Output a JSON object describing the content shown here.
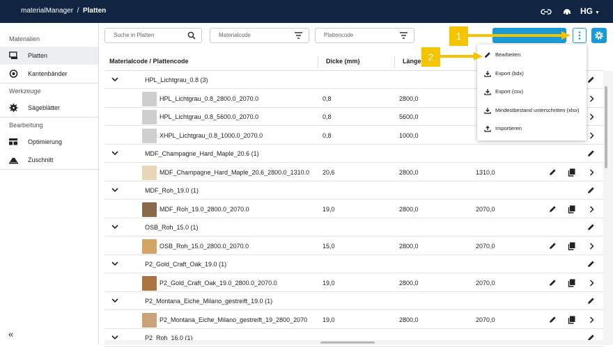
{
  "app": {
    "name": "materialManager",
    "separator": "/",
    "page": "Platten",
    "brand": "HG"
  },
  "sidebar": {
    "sections": [
      {
        "title": "Materialien",
        "items": [
          {
            "label": "Platten",
            "icon": "sheet-icon",
            "active": true
          },
          {
            "label": "Kantenbänder",
            "icon": "edge-band-icon",
            "active": false
          }
        ]
      },
      {
        "title": "Werkzeuge",
        "items": [
          {
            "label": "Sägeblätter",
            "icon": "saw-blade-icon",
            "active": false
          }
        ]
      },
      {
        "title": "Bearbeitung",
        "items": [
          {
            "label": "Optimierung",
            "icon": "optimization-icon",
            "active": false
          },
          {
            "label": "Zuschnitt",
            "icon": "cutting-icon",
            "active": false
          }
        ]
      }
    ],
    "collapse": "«"
  },
  "filters": {
    "search_placeholder": "Suche in Platten",
    "materialcode_placeholder": "Materialcode",
    "plattencode_placeholder": "Plattencode"
  },
  "table": {
    "headers": [
      "Materialcode / Plattencode",
      "Dicke (mm)",
      "Länge"
    ]
  },
  "groups": [
    {
      "name": "HPL_Lichtgrau_0.8 (3)",
      "rows": [
        {
          "code": "HPL_Lichtgrau_0.8_2800.0_2070.0",
          "dicke": "0,8",
          "laenge": "2800,0",
          "breite": "",
          "thumb": "#cfcfcf"
        },
        {
          "code": "HPL_Lichtgrau_0.8_5600.0_2070.0",
          "dicke": "0,8",
          "laenge": "5600,0",
          "breite": "",
          "thumb": "#cfcfcf"
        },
        {
          "code": "XHPL_Lichtgrau_0.8_1000.0_2070.0",
          "dicke": "0,8",
          "laenge": "1000,0",
          "breite": "",
          "thumb": "#cfcfcf"
        }
      ]
    },
    {
      "name": "MDF_Champagne_Hard_Maple_20.6 (1)",
      "rows": [
        {
          "code": "MDF_Champagne_Hard_Maple_20.6_2800.0_1310.0",
          "dicke": "20,6",
          "laenge": "2800,0",
          "breite": "1310,0",
          "thumb": "#e9d5b8"
        }
      ]
    },
    {
      "name": "MDF_Roh_19.0 (1)",
      "rows": [
        {
          "code": "MDF_Roh_19.0_2800.0_2070.0",
          "dicke": "19,0",
          "laenge": "2800,0",
          "breite": "2070,0",
          "thumb": "#8a6a4c"
        }
      ]
    },
    {
      "name": "OSB_Roh_15.0 (1)",
      "rows": [
        {
          "code": "OSB_Roh_15.0_2800.0_2070.0",
          "dicke": "15,0",
          "laenge": "2800,0",
          "breite": "2070,0",
          "thumb": "#d4a467"
        }
      ]
    },
    {
      "name": "P2_Gold_Craft_Oak_19.0 (1)",
      "rows": [
        {
          "code": "P2_Gold_Craft_Oak_19.0_2800.0_2070.0",
          "dicke": "19,0",
          "laenge": "2800,0",
          "breite": "2070,0",
          "thumb": "#a9743f"
        }
      ]
    },
    {
      "name": "P2_Montana_Eiche_Milano_gestreift_19.0 (1)",
      "rows": [
        {
          "code": "P2_Montana_Eiche_Milano_gestreift_19_2800_2070",
          "dicke": "19,0",
          "laenge": "2800,0",
          "breite": "2070,0",
          "thumb": "#cba27a"
        }
      ]
    },
    {
      "name": "P2_Roh_16.0 (1)",
      "rows": []
    }
  ],
  "menu": [
    {
      "label": "Bearbeiten",
      "icon": "pencil-icon"
    },
    {
      "label": "Export (bdx)",
      "icon": "download-icon"
    },
    {
      "label": "Export (csv)",
      "icon": "download-icon"
    },
    {
      "label": "Mindestbestand unterschritten (xlsx)",
      "icon": "download-icon"
    },
    {
      "label": "Importieren",
      "icon": "upload-icon"
    }
  ],
  "callouts": [
    "1",
    "2"
  ],
  "colors": {
    "topbar": "#112543",
    "accent": "#1a9bd7",
    "callout": "#f5c400"
  }
}
